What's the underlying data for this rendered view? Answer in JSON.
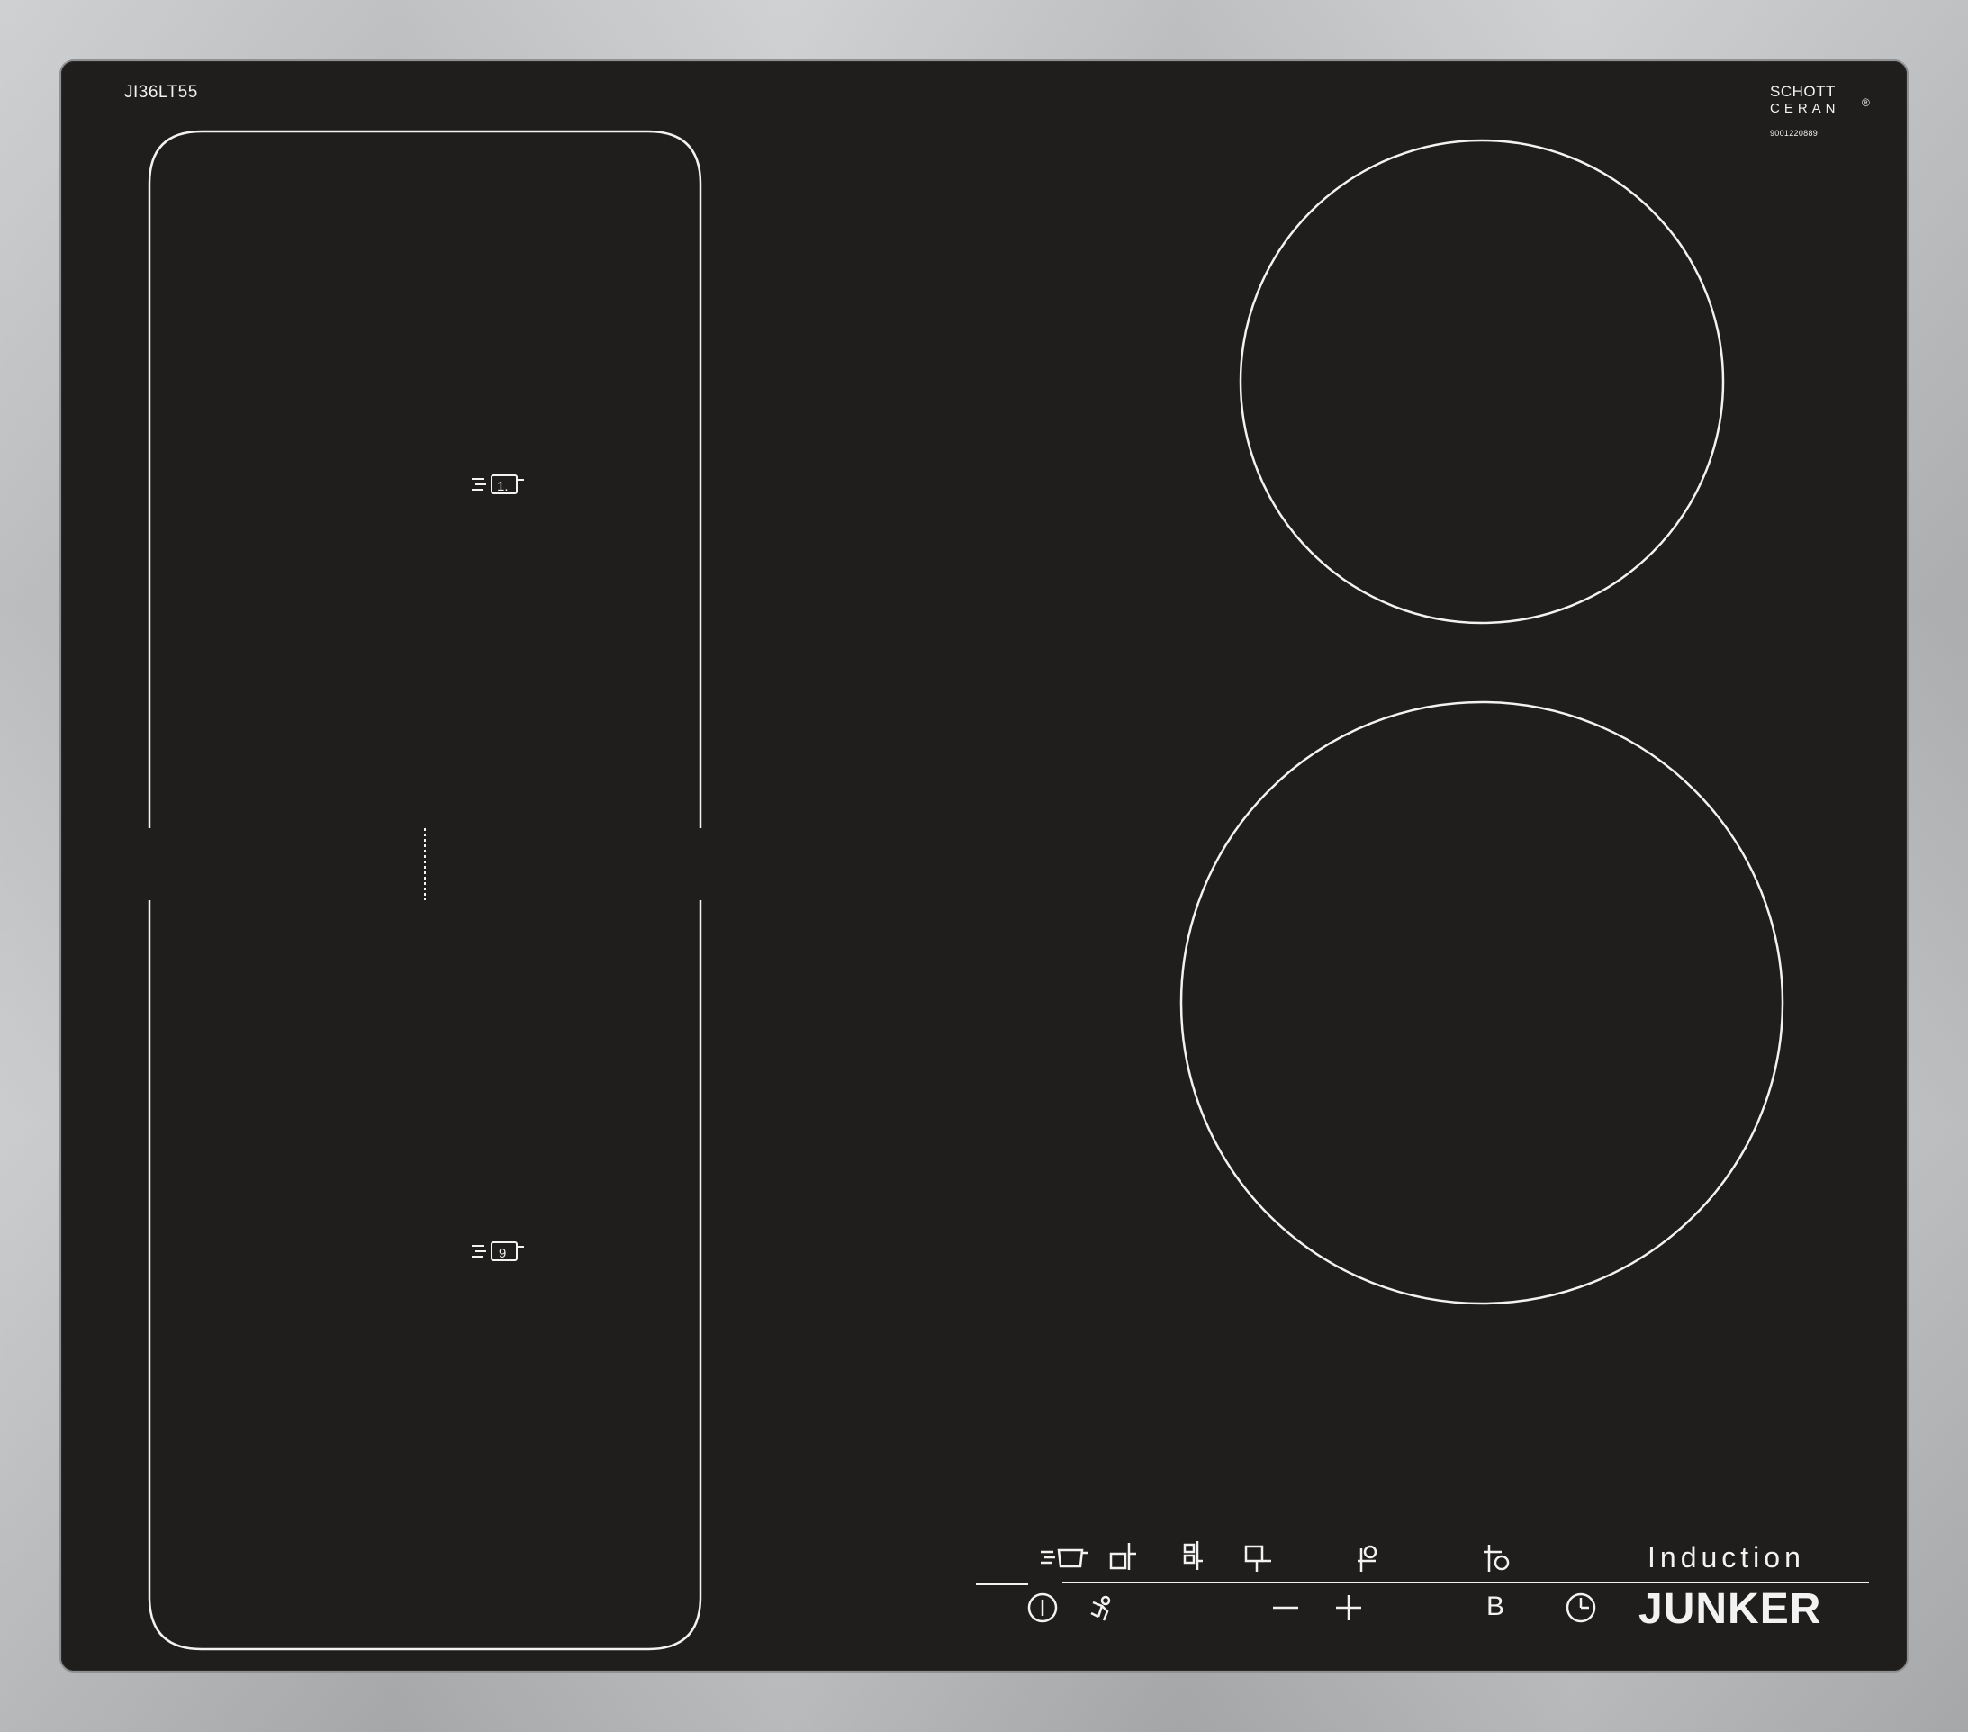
{
  "cooktop": {
    "model_label": "JI36LT55",
    "glass_brand_line1": "SCHOTT",
    "glass_brand_line2": "CERAN",
    "glass_brand_mark": "®",
    "serial_number": "9001220889",
    "type_label": "Induction",
    "brand_label": "JUNKER",
    "booster_letter": "B"
  },
  "zones": {
    "flex_zone_front_digit": "1.",
    "flex_zone_rear_digit": "9"
  },
  "icons": {
    "power": "power-icon",
    "child_lock": "child-lock-icon",
    "minus": "minus-icon",
    "plus": "plus-icon",
    "booster": "booster-b-icon",
    "timer": "clock-icon",
    "move_function": "pan-move-icon",
    "zone_select_1": "zone-select-left-front-icon",
    "zone_select_2": "zone-select-left-rear-icon",
    "zone_select_3": "zone-select-center-icon",
    "zone_select_4": "zone-select-right-rear-icon",
    "zone_select_5": "zone-select-right-front-icon"
  },
  "colors": {
    "glass": "#1f1e1c",
    "markings": "#f2f2f2",
    "frame": "#bfc1c3"
  }
}
